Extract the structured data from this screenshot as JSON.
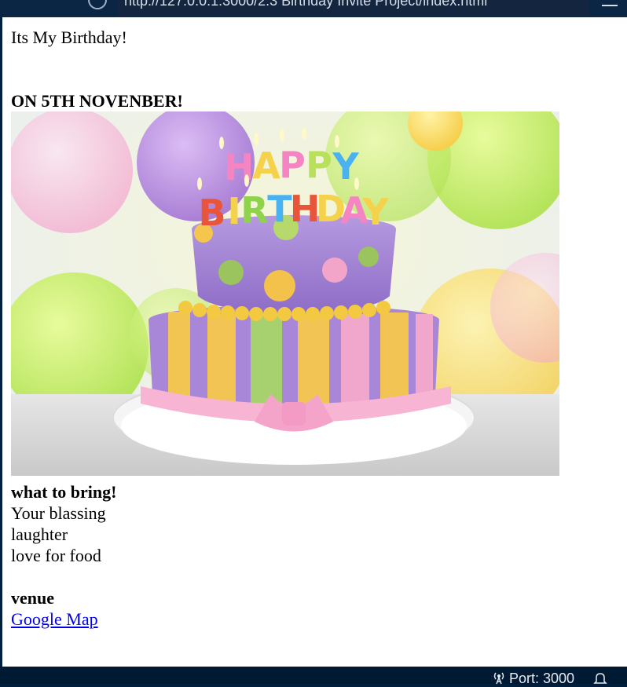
{
  "browser": {
    "url": "http://127.0.0.1:3000/2.3 Birthday Invite Project/index.html"
  },
  "page": {
    "title": "Its My Birthday!",
    "date_heading": "ON 5TH NOVENBER!",
    "image_alt": "Birthday cake",
    "bring_heading": "what to bring!",
    "bring_items": [
      "Your blassing",
      "laughter",
      "love for food"
    ],
    "venue_heading": "venue",
    "venue_link": "Google Map"
  },
  "statusbar": {
    "port": "Port: 3000"
  },
  "icons": {
    "port": "broadcast-icon",
    "bell": "bell-icon"
  }
}
